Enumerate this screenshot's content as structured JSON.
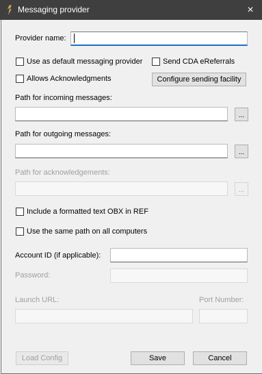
{
  "window": {
    "title": "Messaging provider",
    "close_icon": "×"
  },
  "provider_name": {
    "label": "Provider name:",
    "value": ""
  },
  "checkboxes": {
    "default_provider": {
      "label": "Use as default messaging provider",
      "checked": false
    },
    "send_cda": {
      "label": "Send CDA eReferrals",
      "checked": false
    },
    "acknowledgments": {
      "label": "Allows Acknowledgments",
      "checked": false
    },
    "include_obx": {
      "label": "Include a formatted text OBX in REF",
      "checked": false
    },
    "same_path": {
      "label": "Use the same path on all computers",
      "checked": false
    }
  },
  "buttons": {
    "configure": "Configure sending facility",
    "browse": "...",
    "load_config": "Load Config",
    "save": "Save",
    "cancel": "Cancel"
  },
  "paths": {
    "incoming": {
      "label": "Path for incoming messages:",
      "value": ""
    },
    "outgoing": {
      "label": "Path for outgoing messages:",
      "value": ""
    },
    "ack": {
      "label": "Path for acknowledgements:",
      "value": ""
    }
  },
  "account": {
    "label": "Account ID (if applicable):",
    "value": ""
  },
  "password": {
    "label": "Password:",
    "value": ""
  },
  "launch_url": {
    "label": "Launch URL:",
    "value": ""
  },
  "port": {
    "label": "Port Number:",
    "value": ""
  }
}
